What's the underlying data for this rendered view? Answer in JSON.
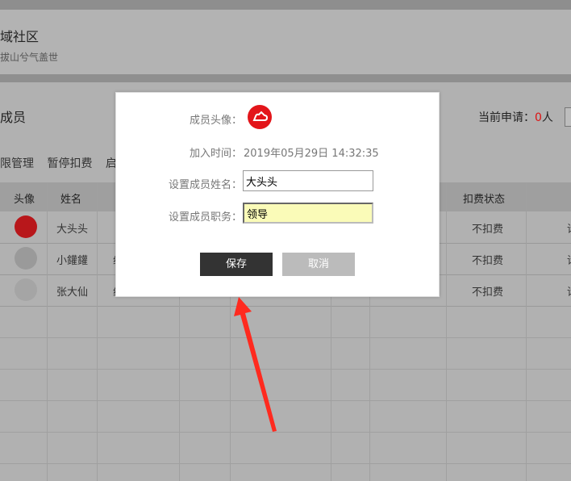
{
  "background": {
    "community_name": "域社区",
    "community_slogan": "拔山兮气盖世",
    "panel_title": "成员",
    "apply_label": "当前申请：",
    "apply_count": "0",
    "apply_unit": "人",
    "actions": [
      "限管理",
      "暂停扣费",
      "启"
    ],
    "table": {
      "headers": {
        "avatar": "头像",
        "name": "姓名",
        "status": "扣费状态"
      },
      "rows": [
        {
          "name": "大头头",
          "status": "不扣费",
          "suffix": "请"
        },
        {
          "name": "小鑵鑵",
          "status": "不扣费",
          "suffix": "请",
          "col3": "组"
        },
        {
          "name": "张大仙",
          "status": "不扣费",
          "suffix": "请",
          "col3": "组"
        }
      ]
    }
  },
  "modal": {
    "avatar_label": "成员头像：",
    "join_time_label": "加入时间：",
    "join_time": "2019年05月29日 14:32:35",
    "name_label": "设置成员姓名：",
    "name_value": "大头头",
    "job_label": "设置成员职务：",
    "job_value": "领导",
    "save_label": "保存",
    "cancel_label": "取消"
  },
  "colors": {
    "accent": "#e3151a",
    "arrow": "#ff2a1f",
    "save_button": "#333333",
    "cancel_button": "#bbbbbb",
    "job_field": "#fafbb8"
  }
}
